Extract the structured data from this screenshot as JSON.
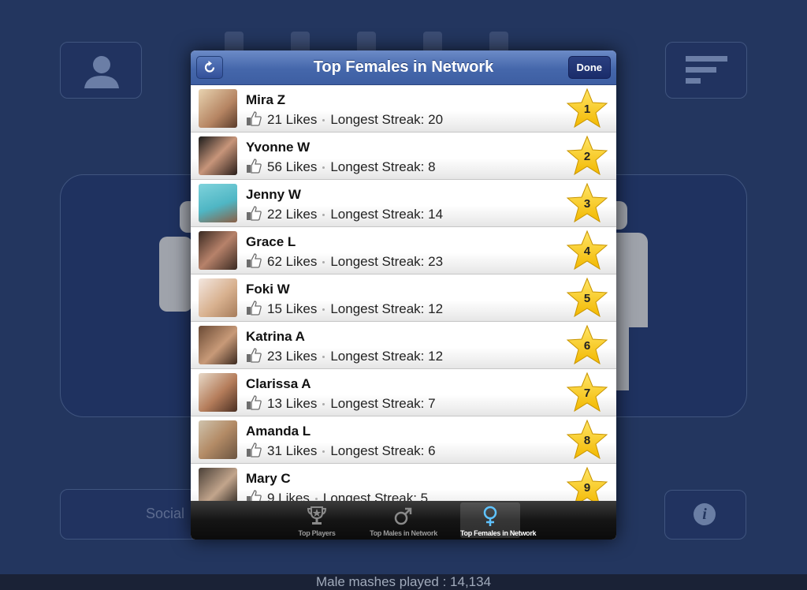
{
  "modal": {
    "title": "Top Females in Network",
    "done_label": "Done"
  },
  "colors": {
    "nav_bar": "#4567ab",
    "star": "#f5c400",
    "background": "#23365f"
  },
  "rows": [
    {
      "name": "Mira Z",
      "likes": "21 Likes",
      "streak": "Longest Streak: 20",
      "rank": "1"
    },
    {
      "name": "Yvonne W",
      "likes": "56 Likes",
      "streak": "Longest Streak: 8",
      "rank": "2"
    },
    {
      "name": "Jenny W",
      "likes": "22 Likes",
      "streak": "Longest Streak: 14",
      "rank": "3"
    },
    {
      "name": "Grace L",
      "likes": "62 Likes",
      "streak": "Longest Streak: 23",
      "rank": "4"
    },
    {
      "name": "Foki W",
      "likes": "15 Likes",
      "streak": "Longest Streak: 12",
      "rank": "5"
    },
    {
      "name": "Katrina A",
      "likes": "23 Likes",
      "streak": "Longest Streak: 12",
      "rank": "6"
    },
    {
      "name": "Clarissa A",
      "likes": "13 Likes",
      "streak": "Longest Streak: 7",
      "rank": "7"
    },
    {
      "name": "Amanda L",
      "likes": "31 Likes",
      "streak": "Longest Streak: 6",
      "rank": "8"
    },
    {
      "name": "Mary C",
      "likes": "9 Likes",
      "streak": "Longest Streak: 5",
      "rank": "9"
    }
  ],
  "tabs": [
    {
      "label": "Top Players",
      "icon": "trophy-icon"
    },
    {
      "label": "Top Males in Network",
      "icon": "male-symbol-icon"
    },
    {
      "label": "Top Females in Network",
      "icon": "female-symbol-icon",
      "selected": true
    }
  ],
  "background_app": {
    "social_label": "Social",
    "footer_text": "Male mashes played : 14,134"
  }
}
